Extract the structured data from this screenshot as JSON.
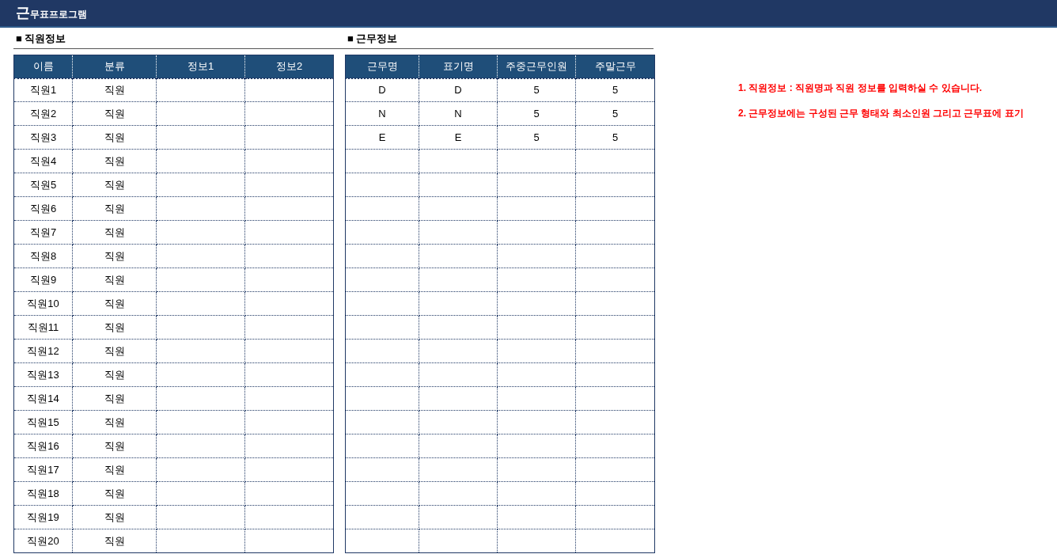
{
  "app_title": "근무표프로그램",
  "employee_section": {
    "title": "■ 직원정보",
    "columns": [
      "이름",
      "분류",
      "정보1",
      "정보2"
    ],
    "rows": [
      {
        "name": "직원1",
        "category": "직원"
      },
      {
        "name": "직원2",
        "category": "직원"
      },
      {
        "name": "직원3",
        "category": "직원"
      },
      {
        "name": "직원4",
        "category": "직원"
      },
      {
        "name": "직원5",
        "category": "직원"
      },
      {
        "name": "직원6",
        "category": "직원"
      },
      {
        "name": "직원7",
        "category": "직원"
      },
      {
        "name": "직원8",
        "category": "직원"
      },
      {
        "name": "직원9",
        "category": "직원"
      },
      {
        "name": "직원10",
        "category": "직원"
      },
      {
        "name": "직원11",
        "category": "직원"
      },
      {
        "name": "직원12",
        "category": "직원"
      },
      {
        "name": "직원13",
        "category": "직원"
      },
      {
        "name": "직원14",
        "category": "직원"
      },
      {
        "name": "직원15",
        "category": "직원"
      },
      {
        "name": "직원16",
        "category": "직원"
      },
      {
        "name": "직원17",
        "category": "직원"
      },
      {
        "name": "직원18",
        "category": "직원"
      },
      {
        "name": "직원19",
        "category": "직원"
      },
      {
        "name": "직원20",
        "category": "직원"
      }
    ]
  },
  "shift_section": {
    "title": "■ 근무정보",
    "columns": [
      "근무명",
      "표기명",
      "주중근무인원",
      "주말근무"
    ],
    "rows": [
      {
        "shift_name": "D",
        "label": "D",
        "weekday_staff": "5",
        "weekend_staff": "5"
      },
      {
        "shift_name": "N",
        "label": "N",
        "weekday_staff": "5",
        "weekend_staff": "5"
      },
      {
        "shift_name": "E",
        "label": "E",
        "weekday_staff": "5",
        "weekend_staff": "5"
      }
    ]
  },
  "notes": [
    "1. 직원정보 : 직원명과 직원 정보를 입력하실 수 있습니다.",
    "2. 근무정보에는 구성된 근무 형태와 최소인원 그리고 근무표에 표기"
  ]
}
